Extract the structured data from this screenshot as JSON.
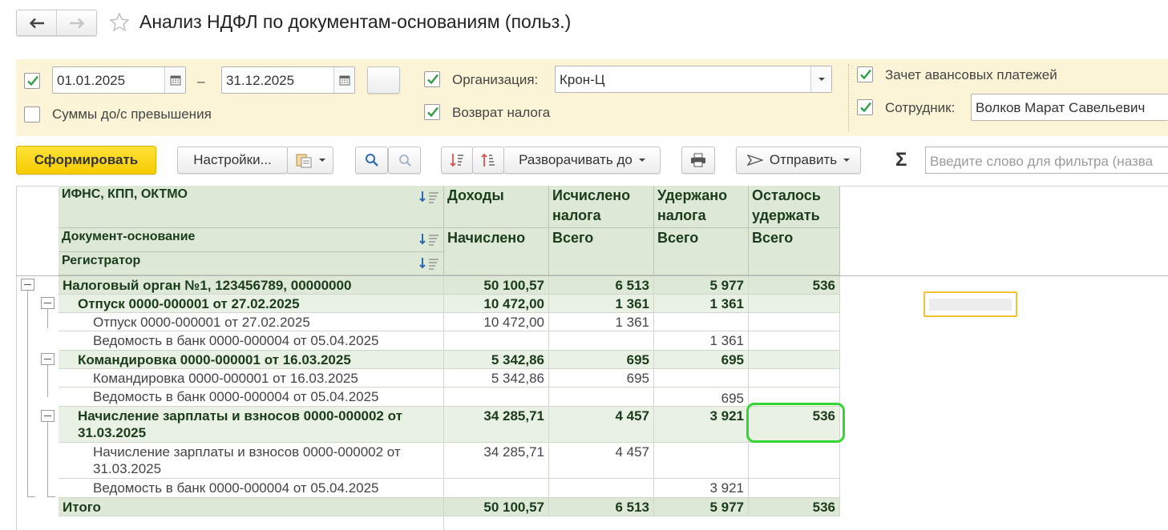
{
  "window": {
    "title": "Анализ НДФЛ по документам-основаниям (польз.)"
  },
  "filters": {
    "date_from": "01.01.2025",
    "date_dash": "–",
    "date_to": "31.12.2025",
    "more_button": "...",
    "exceed_sums_label": "Суммы до/с превышения",
    "exceed_sums_checked": false,
    "org_label": "Организация:",
    "org_value": "Крон-Ц",
    "tax_return_label": "Возврат налога",
    "advance_label": "Зачет авансовых платежей",
    "employee_label": "Сотрудник:",
    "employee_value": "Волков Марат Савельевич"
  },
  "toolbar": {
    "generate": "Сформировать",
    "settings": "Настройки...",
    "expand": "Разворачивать до",
    "send": "Отправить",
    "sum_symbol": "Σ",
    "search_placeholder": "Введите слово для фильтра (назва"
  },
  "table": {
    "headers": {
      "group": "ИФНС, КПП, ОКТМО",
      "doc": "Документ-основание",
      "registrar": "Регистратор",
      "income_top": "Доходы",
      "income_sub": "Начислено",
      "calc_top": "Исчислено налога",
      "calc_sub": "Всего",
      "held_top": "Удержано налога",
      "held_sub": "Всего",
      "left_top": "Осталось удержать",
      "left_sub": "Всего"
    },
    "rows": [
      {
        "name": "Налоговый орган №1, 123456789, 00000000",
        "income": "50 100,57",
        "calc": "6 513",
        "held": "5 977",
        "left": "536"
      },
      {
        "name": "Отпуск 0000-000001 от 27.02.2025",
        "income": "10 472,00",
        "calc": "1 361",
        "held": "1 361",
        "left": ""
      },
      {
        "name": "Отпуск 0000-000001 от 27.02.2025",
        "income": "10 472,00",
        "calc": "1 361",
        "held": "",
        "left": ""
      },
      {
        "name": "Ведомость в банк 0000-000004 от 05.04.2025",
        "income": "",
        "calc": "",
        "held": "1 361",
        "left": ""
      },
      {
        "name": "Командировка 0000-000001 от 16.03.2025",
        "income": "5 342,86",
        "calc": "695",
        "held": "695",
        "left": ""
      },
      {
        "name": "Командировка 0000-000001 от 16.03.2025",
        "income": "5 342,86",
        "calc": "695",
        "held": "",
        "left": ""
      },
      {
        "name": "Ведомость в банк 0000-000004 от 05.04.2025",
        "income": "",
        "calc": "",
        "held": "695",
        "left": ""
      },
      {
        "name": "Начисление зарплаты и взносов 0000-000002 от 31.03.2025",
        "income": "34 285,71",
        "calc": "4 457",
        "held": "3 921",
        "left": "536"
      },
      {
        "name": "Начисление зарплаты и взносов 0000-000002 от 31.03.2025",
        "income": "34 285,71",
        "calc": "4 457",
        "held": "",
        "left": ""
      },
      {
        "name": "Ведомость в банк 0000-000004 от 05.04.2025",
        "income": "",
        "calc": "",
        "held": "3 921",
        "left": ""
      },
      {
        "name": "Итого",
        "income": "50 100,57",
        "calc": "6 513",
        "held": "5 977",
        "left": "536"
      }
    ]
  },
  "colors": {
    "accent_yellow": "#f6cc00",
    "filter_bg": "#fbf4d6",
    "header_green": "#dde9d6",
    "highlight_green": "#33d633",
    "highlight_yellow": "#f2c230"
  }
}
